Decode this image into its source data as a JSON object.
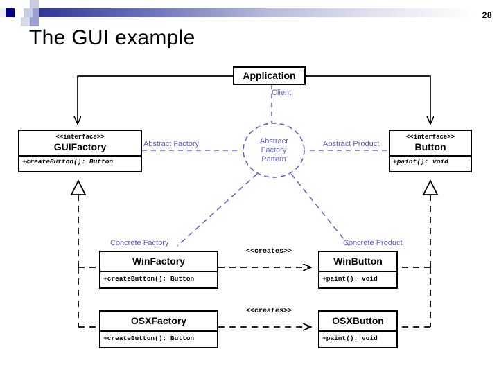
{
  "slide": {
    "title": "The GUI example",
    "page_number": "28"
  },
  "diagram": {
    "type": "uml-class-diagram",
    "classes": [
      {
        "id": "application",
        "name": "Application",
        "stereotype": "",
        "operations": []
      },
      {
        "id": "guifactory",
        "name": "GUIFactory",
        "stereotype": "<<interface>>",
        "operations": [
          "+createButton(): Button"
        ]
      },
      {
        "id": "button",
        "name": "Button",
        "stereotype": "<<interface>>",
        "operations": [
          "+paint(): void"
        ]
      },
      {
        "id": "winfactory",
        "name": "WinFactory",
        "stereotype": "",
        "operations": [
          "+createButton(): Button"
        ]
      },
      {
        "id": "osxfactory",
        "name": "OSXFactory",
        "stereotype": "",
        "operations": [
          "+createButton(): Button"
        ]
      },
      {
        "id": "winbutton",
        "name": "WinButton",
        "stereotype": "",
        "operations": [
          "+paint(): void"
        ]
      },
      {
        "id": "osxbutton",
        "name": "OSXButton",
        "stereotype": "",
        "operations": [
          "+paint(): void"
        ]
      }
    ],
    "pattern_node": {
      "line1": "Abstract",
      "line2": "Factory",
      "line3": "Pattern"
    },
    "role_labels": {
      "client": "Client",
      "abstract_factory": "Abstract Factory",
      "abstract_product": "Abstract Product",
      "concrete_factory": "Concrete Factory",
      "concrete_product": "Concrete Product"
    },
    "relations": [
      {
        "label": "<<creates>>",
        "from": "winfactory",
        "to": "winbutton"
      },
      {
        "label": "<<creates>>",
        "from": "osxfactory",
        "to": "osxbutton"
      }
    ],
    "colors": {
      "pattern_accent": "#5a5fd0",
      "line": "#000000",
      "band_start": "#272f8c"
    }
  }
}
